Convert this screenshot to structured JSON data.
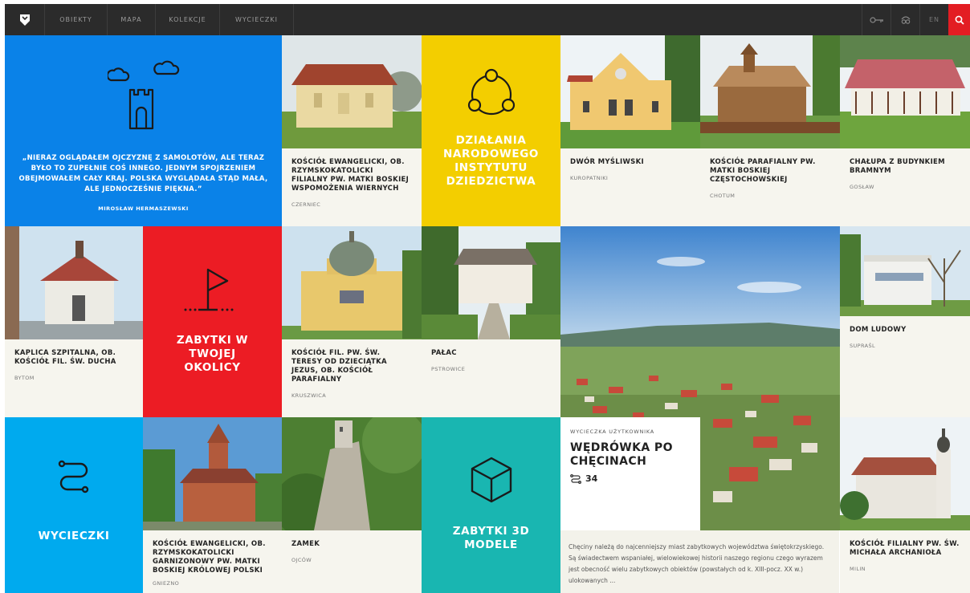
{
  "nav": {
    "items": [
      "OBIEKTY",
      "MAPA",
      "KOLEKCJE",
      "WYCIECZKI"
    ],
    "lang": "EN",
    "colors": {
      "bar": "#2b2b2b",
      "search": "#e31d23"
    }
  },
  "quote": {
    "text": "„NIERAZ OGLĄDAŁEM OJCZYZNĘ Z SAMOLOTÓW, ALE TERAZ BYŁO TO ZUPEŁNIE COŚ INNEGO. JEDNYM SPOJRZENIEM OBEJMOWAŁEM CAŁY KRAJ. POLSKA WYGLĄDAŁA STĄD MAŁA, ALE JEDNOCZEŚNIE PIĘKNA.”",
    "author": "MIROSŁAW HERMASZEWSKI",
    "color": "#0a82e8"
  },
  "promos": {
    "nid": "DZIAŁANIA NARODOWEGO INSTYTUTU DZIEDZICTWA",
    "nearby": "ZABYTKI W TWOJEJ OKOLICY",
    "trips": "WYCIECZKI",
    "models": "ZABYTKI 3D MODELE",
    "colors": {
      "nid": "#f3ce00",
      "nearby": "#ec1c24",
      "trips": "#00aaee",
      "models": "#19b6b1"
    }
  },
  "monuments": [
    {
      "title": "KOŚCIÓŁ EWANGELICKI, OB. RZYMSKOKATOLICKI FILIALNY PW. MATKI BOSKIEJ WSPOMOŻENIA WIERNYCH",
      "place": "CZERNIEC"
    },
    {
      "title": "DWÓR MYŚLIWSKI",
      "place": "KUROPATNIKI"
    },
    {
      "title": "KOŚCIÓŁ PARAFIALNY PW. MATKI BOSKIEJ CZĘSTOCHOWSKIEJ",
      "place": "CHOTUM"
    },
    {
      "title": "CHAŁUPA Z BUDYNKIEM BRAMNYM",
      "place": "GOSŁAW"
    },
    {
      "title": "KAPLICA SZPITALNA, OB. KOŚCIÓŁ FIL. ŚW. DUCHA",
      "place": "BYTOM"
    },
    {
      "title": "KOŚCIÓŁ FIL. PW. ŚW. TERESY OD DZIECIĄTKA JEZUS, OB. KOŚCIÓŁ PARAFIALNY",
      "place": "KRUSZWICA"
    },
    {
      "title": "PAŁAC",
      "place": "PSTROWICE"
    },
    {
      "title": "DOM LUDOWY",
      "place": "SUPRAŚL"
    },
    {
      "title": "KOŚCIÓŁ EWANGELICKI, OB. RZYMSKOKATOLICKI GARNIZONOWY PW. MATKI BOSKIEJ KRÓLOWEJ POLSKI",
      "place": "GNIEZNO"
    },
    {
      "title": "ZAMEK",
      "place": "OJCÓW"
    },
    {
      "title": "KOŚCIÓŁ FILIALNY PW. ŚW. MICHAŁA ARCHANIOŁA",
      "place": "MILIN"
    }
  ],
  "trip": {
    "kind": "WYCIECZKA UŻYTKOWNIKA",
    "title": "WĘDRÓWKA PO CHĘCINACH",
    "count": "34",
    "description": "Chęciny należą do najcenniejszy miast zabytkowych województwa świętokrzyskiego. Są świadectwem wspaniałej, wielowiekowej historii naszego regionu czego wyrazem jest obecność wielu zabytkowych obiektów (powstałych od k. XIII-pocz. XX w.) ulokowanych ..."
  }
}
